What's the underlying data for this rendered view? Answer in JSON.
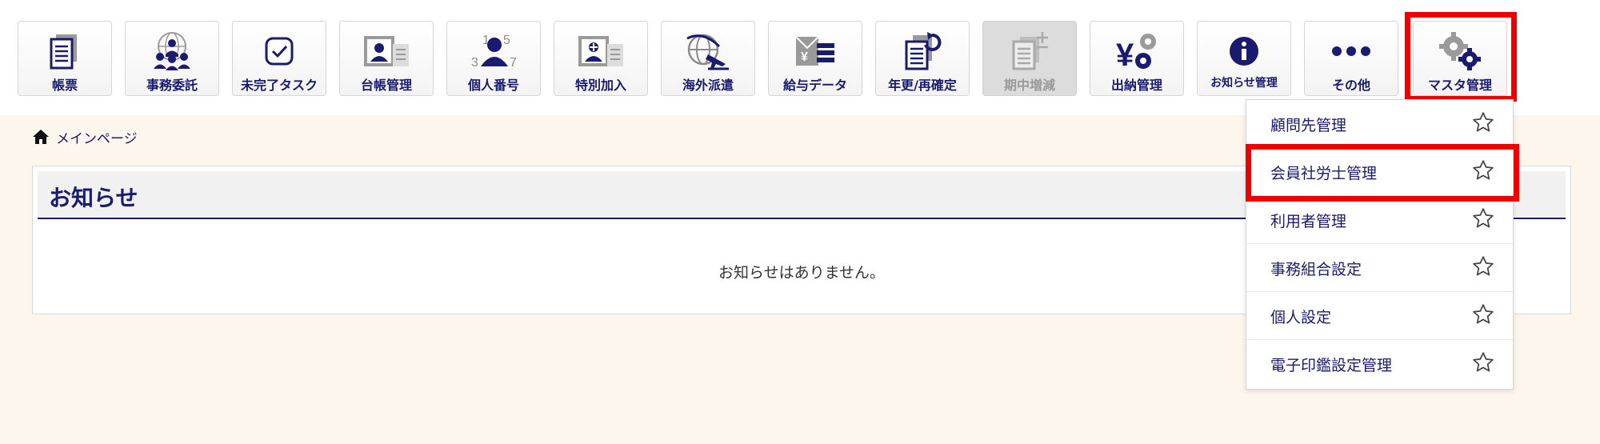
{
  "nav": {
    "items": [
      {
        "label": "帳票",
        "icon": "document-list-icon"
      },
      {
        "label": "事務委託",
        "icon": "group-globe-icon"
      },
      {
        "label": "未完了タスク",
        "icon": "checkbox-icon"
      },
      {
        "label": "台帳管理",
        "icon": "id-card-icon"
      },
      {
        "label": "個人番号",
        "icon": "person-number-icon"
      },
      {
        "label": "特別加入",
        "icon": "special-card-icon"
      },
      {
        "label": "海外派遣",
        "icon": "globe-plane-icon"
      },
      {
        "label": "給与データ",
        "icon": "yen-list-icon"
      },
      {
        "label": "年更/再確定",
        "icon": "document-refresh-icon"
      },
      {
        "label": "期中増減",
        "icon": "document-plusminus-icon",
        "disabled": true
      },
      {
        "label": "出納管理",
        "icon": "yen-gear-icon"
      },
      {
        "label": "お知らせ管理",
        "icon": "info-icon"
      },
      {
        "label": "その他",
        "icon": "more-dots-icon"
      },
      {
        "label": "マスタ管理",
        "icon": "gears-icon"
      }
    ]
  },
  "breadcrumb": {
    "label": "メインページ",
    "icon": "home-icon"
  },
  "notice": {
    "title": "お知らせ",
    "empty": "お知らせはありません。"
  },
  "dropdown": {
    "items": [
      {
        "label": "顧問先管理"
      },
      {
        "label": "会員社労士管理"
      },
      {
        "label": "利用者管理"
      },
      {
        "label": "事務組合設定"
      },
      {
        "label": "個人設定"
      },
      {
        "label": "電子印鑑設定管理"
      }
    ],
    "star_icon": "star-outline-icon"
  },
  "colors": {
    "navy": "#1a1a6e",
    "icon_gray": "#8c8c8c",
    "highlight": "#ee0000",
    "page_bg": "#fdf6ec"
  }
}
